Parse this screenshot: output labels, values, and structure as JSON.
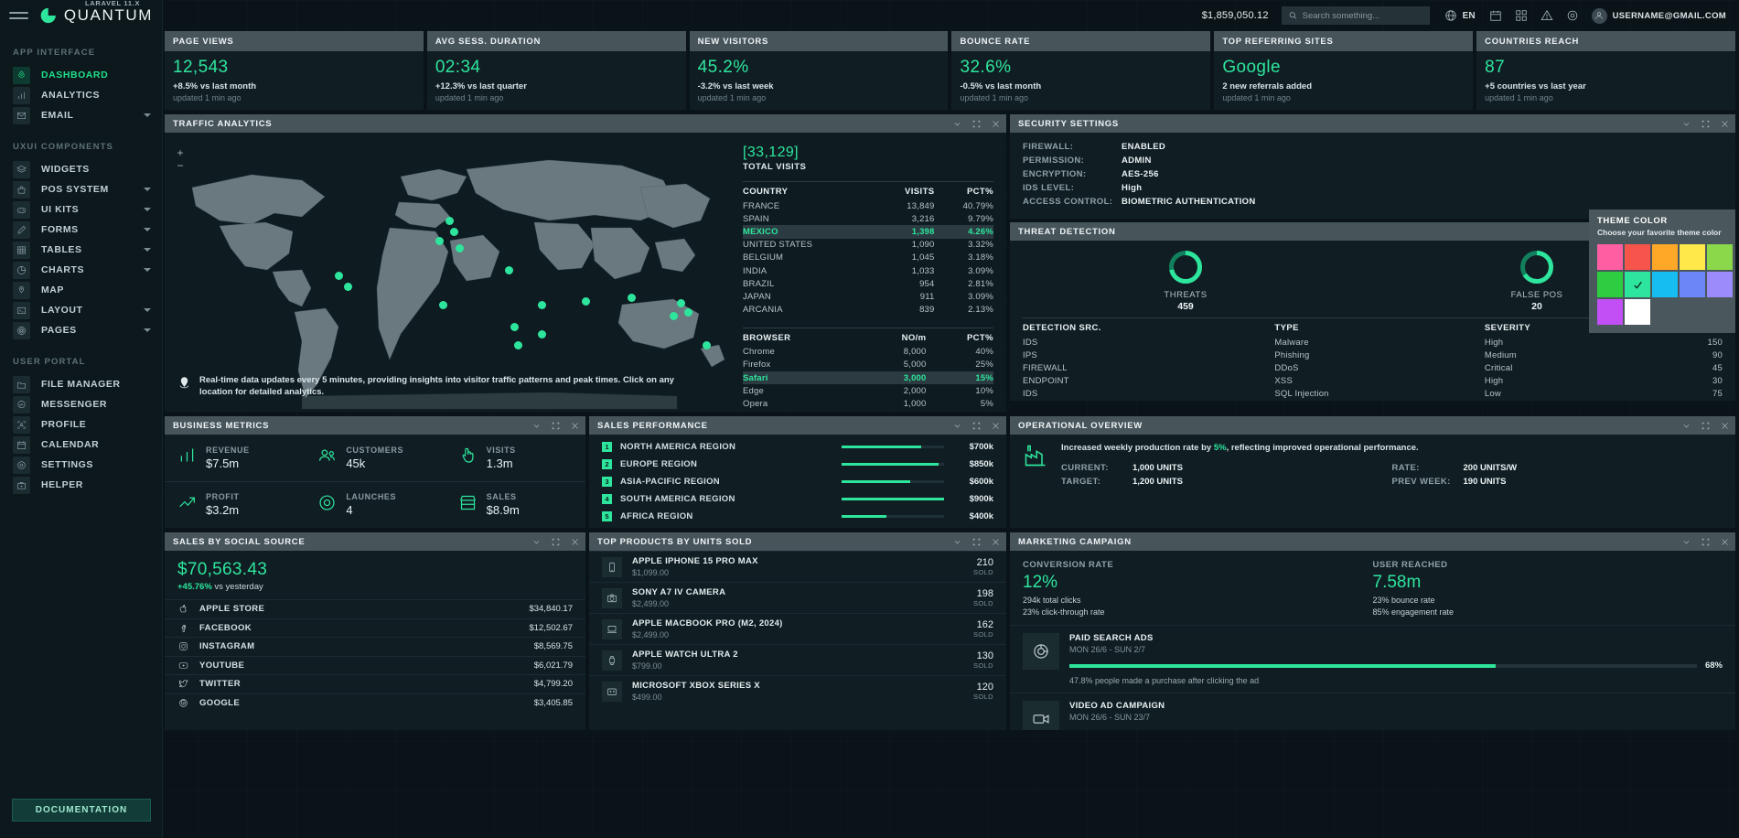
{
  "brand": {
    "name": "QUANTUM",
    "version": "LARAVEL 11.X",
    "doc_button": "DOCUMENTATION"
  },
  "sidebar": {
    "sections": [
      {
        "title": "APP INTERFACE",
        "items": [
          {
            "label": "DASHBOARD",
            "icon": "rocket-icon",
            "active": true,
            "caret": false
          },
          {
            "label": "ANALYTICS",
            "icon": "bar-chart-icon",
            "active": false,
            "caret": false
          },
          {
            "label": "EMAIL",
            "icon": "envelope-icon",
            "active": false,
            "caret": true
          }
        ]
      },
      {
        "title": "UXUI COMPONENTS",
        "items": [
          {
            "label": "WIDGETS",
            "icon": "layers-icon",
            "active": false,
            "caret": false
          },
          {
            "label": "POS SYSTEM",
            "icon": "bag-icon",
            "active": false,
            "caret": true
          },
          {
            "label": "UI KITS",
            "icon": "gamepad-icon",
            "active": false,
            "caret": true
          },
          {
            "label": "FORMS",
            "icon": "pencil-icon",
            "active": false,
            "caret": true
          },
          {
            "label": "TABLES",
            "icon": "grid-icon",
            "active": false,
            "caret": true
          },
          {
            "label": "CHARTS",
            "icon": "pie-chart-icon",
            "active": false,
            "caret": true
          },
          {
            "label": "MAP",
            "icon": "map-pin-icon",
            "active": false,
            "caret": false
          },
          {
            "label": "LAYOUT",
            "icon": "terminal-icon",
            "active": false,
            "caret": true
          },
          {
            "label": "PAGES",
            "icon": "spiral-icon",
            "active": false,
            "caret": true
          }
        ]
      },
      {
        "title": "USER PORTAL",
        "items": [
          {
            "label": "FILE MANAGER",
            "icon": "folder-icon",
            "active": false,
            "caret": false
          },
          {
            "label": "MESSENGER",
            "icon": "chat-icon",
            "active": false,
            "caret": false
          },
          {
            "label": "PROFILE",
            "icon": "user-frame-icon",
            "active": false,
            "caret": false
          },
          {
            "label": "CALENDAR",
            "icon": "calendar-icon",
            "active": false,
            "caret": false
          },
          {
            "label": "SETTINGS",
            "icon": "gear-icon",
            "active": false,
            "caret": false
          },
          {
            "label": "HELPER",
            "icon": "briefcase-icon",
            "active": false,
            "caret": false
          }
        ]
      }
    ]
  },
  "topbar": {
    "balance": "$1,859,050.12",
    "search_placeholder": "Search something...",
    "language": "EN",
    "user_email": "USERNAME@GMAIL.COM",
    "icons": [
      "globe-icon",
      "calendar-icon",
      "apps-icon",
      "warning-icon",
      "gear-icon"
    ]
  },
  "kpis": [
    {
      "title": "PAGE VIEWS",
      "value": "12,543",
      "delta": "+8.5% vs last month",
      "updated": "updated 1 min ago"
    },
    {
      "title": "AVG SESS. DURATION",
      "value": "02:34",
      "delta": "+12.3% vs last quarter",
      "updated": "updated 1 min ago"
    },
    {
      "title": "NEW VISITORS",
      "value": "45.2%",
      "delta": "-3.2% vs last week",
      "updated": "updated 1 min ago"
    },
    {
      "title": "BOUNCE RATE",
      "value": "32.6%",
      "delta": "-0.5% vs last month",
      "updated": "updated 1 min ago"
    },
    {
      "title": "TOP REFERRING SITES",
      "value": "Google",
      "delta": "2 new referrals added",
      "updated": "updated 1 min ago"
    },
    {
      "title": "COUNTRIES REACH",
      "value": "87",
      "delta": "+5 countries vs last year",
      "updated": "updated 1 min ago"
    }
  ],
  "traffic": {
    "title": "TRAFFIC ANALYTICS",
    "zoom_in": "+",
    "zoom_out": "−",
    "total_visits_value": "[33,129]",
    "total_visits_label": "TOTAL VISITS",
    "note": "Real-time data updates every 5 minutes, providing insights into visitor traffic patterns and peak times. Click on any location for detailed analytics.",
    "country_headers": [
      "COUNTRY",
      "VISITS",
      "PCT%"
    ],
    "countries": [
      {
        "name": "FRANCE",
        "visits": "13,849",
        "pct": "40.79%",
        "hl": false
      },
      {
        "name": "SPAIN",
        "visits": "3,216",
        "pct": "9.79%",
        "hl": false
      },
      {
        "name": "MEXICO",
        "visits": "1,398",
        "pct": "4.26%",
        "hl": true
      },
      {
        "name": "UNITED STATES",
        "visits": "1,090",
        "pct": "3.32%",
        "hl": false
      },
      {
        "name": "BELGIUM",
        "visits": "1,045",
        "pct": "3.18%",
        "hl": false
      },
      {
        "name": "INDIA",
        "visits": "1,033",
        "pct": "3.09%",
        "hl": false
      },
      {
        "name": "BRAZIL",
        "visits": "954",
        "pct": "2.81%",
        "hl": false
      },
      {
        "name": "JAPAN",
        "visits": "911",
        "pct": "3.09%",
        "hl": false
      },
      {
        "name": "ARCANIA",
        "visits": "839",
        "pct": "2.13%",
        "hl": false
      }
    ],
    "browser_headers": [
      "BROWSER",
      "NO/m",
      "PCT%"
    ],
    "browsers": [
      {
        "name": "Chrome",
        "num": "8,000",
        "pct": "40%",
        "hl": false
      },
      {
        "name": "Firefox",
        "num": "5,000",
        "pct": "25%",
        "hl": false
      },
      {
        "name": "Safari",
        "num": "3,000",
        "pct": "15%",
        "hl": true
      },
      {
        "name": "Edge",
        "num": "2,000",
        "pct": "10%",
        "hl": false
      },
      {
        "name": "Opera",
        "num": "1,000",
        "pct": "5%",
        "hl": false
      }
    ]
  },
  "security": {
    "title": "SECURITY SETTINGS",
    "rows": [
      {
        "k": "FIREWALL:",
        "v": "ENABLED"
      },
      {
        "k": "PERMISSION:",
        "v": "ADMIN"
      },
      {
        "k": "ENCRYPTION:",
        "v": "AES-256"
      },
      {
        "k": "IDS LEVEL:",
        "v": "High"
      },
      {
        "k": "ACCESS CONTROL:",
        "v": "BIOMETRIC AUTHENTICATION"
      }
    ]
  },
  "threat": {
    "title": "THREAT DETECTION",
    "donuts": [
      {
        "label": "THREATS",
        "value": "459",
        "pct": 72
      },
      {
        "label": "FALSE POS",
        "value": "20",
        "pct": 66
      }
    ],
    "headers": [
      "DETECTION SRC.",
      "TYPE",
      "SEVERITY",
      ""
    ],
    "rows": [
      {
        "src": "IDS",
        "type": "Malware",
        "sev": "High",
        "num": "150"
      },
      {
        "src": "IPS",
        "type": "Phishing",
        "sev": "Medium",
        "num": "90"
      },
      {
        "src": "FIREWALL",
        "type": "DDoS",
        "sev": "Critical",
        "num": "45"
      },
      {
        "src": "ENDPOINT",
        "type": "XSS",
        "sev": "High",
        "num": "30"
      },
      {
        "src": "IDS",
        "type": "SQL Injection",
        "sev": "Low",
        "num": "75"
      }
    ]
  },
  "theme_popup": {
    "title": "THEME COLOR",
    "subtitle": "Choose your favorite theme color",
    "swatches": [
      "#ff5fa2",
      "#f7544c",
      "#ffa726",
      "#ffe84a",
      "#8bd84a",
      "#2ecc40",
      "#2ee59d",
      "#15bdf0",
      "#6d86f7",
      "#9b8bfb",
      "#c14ff5",
      "#ffffff"
    ],
    "selected_index": 6
  },
  "business": {
    "title": "BUSINESS METRICS",
    "cells": [
      {
        "label": "REVENUE",
        "value": "$7.5m",
        "icon": "bar-chart-icon"
      },
      {
        "label": "CUSTOMERS",
        "value": "45k",
        "icon": "users-icon"
      },
      {
        "label": "VISITS",
        "value": "1.3m",
        "icon": "hand-pointer-icon"
      },
      {
        "label": "PROFIT",
        "value": "$3.2m",
        "icon": "trend-up-icon"
      },
      {
        "label": "LAUNCHES",
        "value": "4",
        "icon": "donut-icon"
      },
      {
        "label": "SALES",
        "value": "$8.9m",
        "icon": "store-icon"
      }
    ]
  },
  "sales_perf": {
    "title": "SALES PERFORMANCE",
    "rows": [
      {
        "n": "1",
        "name": "NORTH AMERICA REGION",
        "value": "$700k",
        "pct": 78
      },
      {
        "n": "2",
        "name": "EUROPE REGION",
        "value": "$850k",
        "pct": 95
      },
      {
        "n": "3",
        "name": "ASIA-PACIFIC REGION",
        "value": "$600k",
        "pct": 67
      },
      {
        "n": "4",
        "name": "SOUTH AMERICA REGION",
        "value": "$900k",
        "pct": 100
      },
      {
        "n": "5",
        "name": "AFRICA REGION",
        "value": "$400k",
        "pct": 44
      }
    ]
  },
  "operational": {
    "title": "OPERATIONAL OVERVIEW",
    "note_pre": "Increased weekly production rate by ",
    "note_pct": "5%",
    "note_post": ", reflecting improved operational performance.",
    "left": [
      {
        "k": "CURRENT:",
        "v": "1,000 UNITS"
      },
      {
        "k": "TARGET:",
        "v": "1,200 UNITS"
      }
    ],
    "right": [
      {
        "k": "RATE:",
        "v": "200 UNITS/W"
      },
      {
        "k": "PREV WEEK:",
        "v": "190 UNITS"
      }
    ]
  },
  "social": {
    "title": "SALES BY SOCIAL SOURCE",
    "total": "$70,563.43",
    "delta_pct": "+45.76%",
    "delta_text": " vs yesterday",
    "rows": [
      {
        "name": "APPLE STORE",
        "icon": "apple-icon",
        "amount": "$34,840.17"
      },
      {
        "name": "FACEBOOK",
        "icon": "facebook-icon",
        "amount": "$12,502.67"
      },
      {
        "name": "INSTAGRAM",
        "icon": "instagram-icon",
        "amount": "$8,569.75"
      },
      {
        "name": "YOUTUBE",
        "icon": "youtube-icon",
        "amount": "$6,021.79"
      },
      {
        "name": "TWITTER",
        "icon": "twitter-icon",
        "amount": "$4,799.20"
      },
      {
        "name": "GOOGLE",
        "icon": "google-icon",
        "amount": "$3,405.85"
      }
    ]
  },
  "products": {
    "title": "TOP PRODUCTS BY UNITS SOLD",
    "sold_label": "SOLD",
    "rows": [
      {
        "name": "APPLE IPHONE 15 PRO MAX",
        "price": "$1,099.00",
        "count": "210",
        "icon": "phone-icon"
      },
      {
        "name": "SONY A7 IV CAMERA",
        "price": "$2,499.00",
        "count": "198",
        "icon": "camera-icon"
      },
      {
        "name": "APPLE MACBOOK PRO (M2, 2024)",
        "price": "$2,499.00",
        "count": "162",
        "icon": "laptop-icon"
      },
      {
        "name": "APPLE WATCH ULTRA 2",
        "price": "$799.00",
        "count": "130",
        "icon": "watch-icon"
      },
      {
        "name": "MICROSOFT XBOX SERIES X",
        "price": "$499.00",
        "count": "120",
        "icon": "console-icon"
      }
    ]
  },
  "marketing": {
    "title": "MARKETING CAMPAIGN",
    "conversion_label": "CONVERSION RATE",
    "conversion_value": "12%",
    "conversion_s1": "294k total clicks",
    "conversion_s2": "23% click-through rate",
    "reach_label": "USER REACHED",
    "reach_value": "7.58m",
    "reach_s1": "23% bounce rate",
    "reach_s2": "85% engagement rate",
    "campaigns": [
      {
        "name": "PAID SEARCH ADS",
        "date": "MON 26/6 - SUN 2/7",
        "pct": "68%",
        "pct_num": 68,
        "foot": "47.8% people made a purchase after clicking the ad",
        "icon": "target-icon"
      },
      {
        "name": "VIDEO AD CAMPAIGN",
        "date": "MON 26/6 - SUN 23/7",
        "pct": "",
        "pct_num": 0,
        "foot": "",
        "icon": "video-icon"
      }
    ]
  }
}
